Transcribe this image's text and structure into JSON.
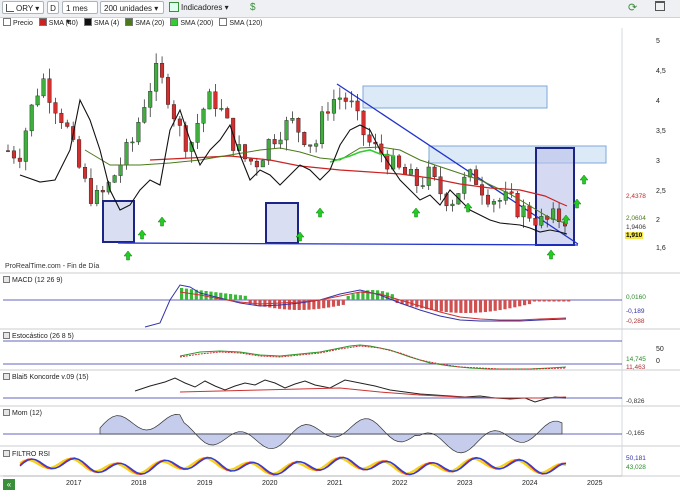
{
  "toolbar": {
    "symbol": "ORY",
    "period_letter": "D",
    "interval": "1 mes",
    "units": "200 unidades",
    "indicators_label": "Indicadores",
    "refresh_icon": "refresh-icon",
    "bag_icon": "money-bag-icon",
    "window_icon": "window-icon",
    "colors": {
      "background": "#eef0f3",
      "accent": "#3a8f3a"
    }
  },
  "price_panel": {
    "credit": "ProRealTime.com - Fin de Día",
    "legend": [
      {
        "label": "Precio",
        "color": "#ffffff"
      },
      {
        "label": "SMA (40)",
        "color": "#cc2222"
      },
      {
        "label": "SMA (4)",
        "color": "#111111"
      },
      {
        "label": "SMA (20)",
        "color": "#4a7a1a"
      },
      {
        "label": "SMA (200)",
        "color": "#33cc33"
      },
      {
        "label": "SMA (120)",
        "color": "#ffffff"
      }
    ],
    "y_ticks": [
      "5",
      "4,5",
      "4",
      "3,5",
      "3",
      "2,5",
      "2",
      "1,6"
    ],
    "y_values": [
      5,
      4.5,
      4,
      3.5,
      3,
      2.5,
      2,
      1.6
    ],
    "tags": [
      {
        "text": "2,4378",
        "color": "#cc2222",
        "bg": "#ffffff"
      },
      {
        "text": "2,0604",
        "color": "#4a7a1a",
        "bg": "#ffffff"
      },
      {
        "text": "1,9406",
        "color": "#333333",
        "bg": "#ffffff"
      },
      {
        "text": "1,910",
        "color": "#000000",
        "bg": "#f5e64a"
      }
    ]
  },
  "panels": [
    {
      "title": "MACD (12 26 9)",
      "tags": [
        {
          "text": "0,0160",
          "color": "#2a8a2a"
        },
        {
          "text": "-0,189",
          "color": "#3333aa"
        },
        {
          "text": "-0,288",
          "color": "#aa3333"
        }
      ]
    },
    {
      "title": "Estocástico (26 8 5)",
      "ticks": [
        "50",
        "0"
      ],
      "tags": [
        {
          "text": "14,745",
          "color": "#2a8a2a"
        },
        {
          "text": "11,463",
          "color": "#aa3333"
        }
      ]
    },
    {
      "title": "Blai5 Koncorde v.09 (15)",
      "tags": [
        {
          "text": "-0,826",
          "color": "#333333"
        }
      ]
    },
    {
      "title": "Mom (12)",
      "tags": [
        {
          "text": "-0,165",
          "color": "#333333"
        }
      ]
    },
    {
      "title": "FILTRO RSI",
      "tags": [
        {
          "text": "50,181",
          "color": "#3333aa"
        },
        {
          "text": "43,028",
          "color": "#2a8a2a"
        }
      ]
    }
  ],
  "x_axis": {
    "labels": [
      "2017",
      "2018",
      "2019",
      "2020",
      "2021",
      "2022",
      "2023",
      "2024",
      "2025"
    ]
  },
  "nav": {
    "back_icon": "double-chevron-left-icon"
  },
  "chart_data": [
    {
      "type": "candlestick",
      "title": "ORY",
      "xlabel": "",
      "ylabel": "",
      "x": [
        "2017",
        "2018",
        "2019",
        "2020",
        "2021",
        "2022",
        "2023",
        "2024",
        "2025"
      ],
      "close_path": [
        2.75,
        2.7,
        3.4,
        4.1,
        3.6,
        3.2,
        2.6,
        2.2,
        2.1,
        2.3,
        2.6,
        2.9,
        3.6,
        4.2,
        3.8,
        3.1,
        2.8,
        3.4,
        3.7,
        3.3,
        2.8,
        2.6,
        2.6,
        2.9,
        3.1,
        3.2,
        3.0,
        2.8,
        3.5,
        3.7,
        3.6,
        3.1,
        2.8,
        2.7,
        2.5,
        2.4,
        2.3,
        2.4,
        2.2,
        2.1,
        2.3,
        2.4,
        2.2,
        2.1,
        2.1,
        2.0,
        1.95,
        1.85,
        1.9,
        1.91
      ],
      "ylim": [
        1.5,
        5.3
      ],
      "y_scale": "log",
      "grid": false
    }
  ]
}
